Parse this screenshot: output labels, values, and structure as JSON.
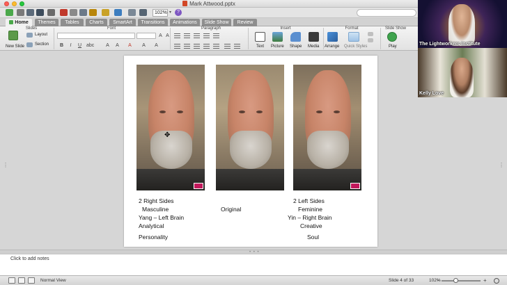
{
  "window": {
    "title": "Mark Attwood.pptx"
  },
  "toolbar": {
    "zoom": "102%",
    "help": "?"
  },
  "ribbon_tabs": [
    "Home",
    "Themes",
    "Tables",
    "Charts",
    "SmartArt",
    "Transitions",
    "Animations",
    "Slide Show",
    "Review"
  ],
  "ribbon": {
    "groups": {
      "slides": "Slides",
      "font": "Font",
      "paragraph": "Paragraph",
      "insert": "Insert",
      "format": "Format",
      "slideshow": "Slide Show"
    },
    "new_slide": "New Slide",
    "layout": "Layout",
    "section": "Section",
    "text": "Text",
    "picture": "Picture",
    "shape": "Shape",
    "media": "Media",
    "arrange": "Arrange",
    "quick_styles": "Quick Styles",
    "play": "Play"
  },
  "slide": {
    "left_caption": [
      "2 Right Sides",
      "Masculine",
      "Yang – Left Brain",
      "Analytical",
      "Personality"
    ],
    "center_caption": "Original",
    "right_caption": [
      "2 Left Sides",
      "Feminine",
      "Yin – Right Brain",
      "Creative",
      "Soul"
    ]
  },
  "notes": {
    "placeholder": "Click to add notes"
  },
  "status": {
    "view": "Normal View",
    "slide_indicator": "Slide 4 of 33",
    "zoom": "102%"
  },
  "videos": [
    {
      "name": "The Lightworkers Institute"
    },
    {
      "name": "Kelly Love"
    }
  ],
  "colors": {
    "accent_green": "#4aa84a",
    "ribbon_tab_bg": "#8e8e8e",
    "window_bg": "#d6d6d6",
    "close": "#fc5f57",
    "minimize": "#fdbc2e",
    "maximize": "#28c840"
  }
}
